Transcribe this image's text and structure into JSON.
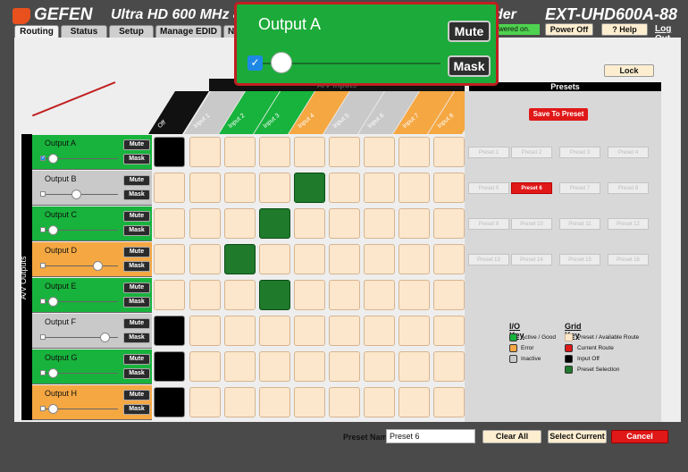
{
  "header": {
    "brand": "GEFEN",
    "product": "Ultra HD 600 MHz 8",
    "product_tail": "der",
    "model": "EXT-UHD600A-88",
    "power_status": "wered on.",
    "power_off": "Power Off",
    "help": "? Help",
    "logout": "Log Out"
  },
  "tabs": [
    "Routing",
    "Status",
    "Setup",
    "Manage EDID",
    "Net"
  ],
  "lock": "Lock",
  "av_inputs": "A/V Inputs",
  "av_outputs": "A/V Outputs",
  "input_labels": [
    "Off",
    "Input 1",
    "Input 2",
    "Input 3",
    "Input 4",
    "Input 5",
    "Input 6",
    "Input 7",
    "Input 8"
  ],
  "outputs": [
    {
      "name": "Output A",
      "mute": "Mute",
      "mask": "Mask",
      "status": "active",
      "checked": true,
      "volume": 0.02
    },
    {
      "name": "Output B",
      "mute": "Mute",
      "mask": "Mask",
      "status": "inactive",
      "checked": false,
      "volume": 0.33
    },
    {
      "name": "Output C",
      "mute": "Mute",
      "mask": "Mask",
      "status": "active",
      "checked": false,
      "volume": 0.02
    },
    {
      "name": "Output D",
      "mute": "Mute",
      "mask": "Mask",
      "status": "error",
      "checked": false,
      "volume": 0.6
    },
    {
      "name": "Output E",
      "mute": "Mute",
      "mask": "Mask",
      "status": "active",
      "checked": false,
      "volume": 0.02
    },
    {
      "name": "Output F",
      "mute": "Mute",
      "mask": "Mask",
      "status": "inactive",
      "checked": false,
      "volume": 0.7
    },
    {
      "name": "Output G",
      "mute": "Mute",
      "mask": "Mask",
      "status": "active",
      "checked": false,
      "volume": 0.02
    },
    {
      "name": "Output H",
      "mute": "Mute",
      "mask": "Mask",
      "status": "error",
      "checked": false,
      "volume": 0.02
    }
  ],
  "routing": [
    "off",
    "4",
    "3",
    "2",
    "3",
    "off",
    "off",
    "off"
  ],
  "presets": {
    "title": "Presets",
    "save": "Save To Preset",
    "items": [
      "Preset 1",
      "Preset 2",
      "Preset 3",
      "Preset 4",
      "Preset 5",
      "Preset 6",
      "Preset 7",
      "Preset 8",
      "Preset 9",
      "Preset 10",
      "Preset 11",
      "Preset 12",
      "Preset 13",
      "Preset 14",
      "Preset 15",
      "Preset 16"
    ],
    "selected": "Preset 6"
  },
  "io_key": {
    "title": "I/O Key",
    "items": [
      "Active / Good",
      "Error",
      "Inactive"
    ]
  },
  "grid_key": {
    "title": "Grid Key",
    "items": [
      "Preset / Available Route",
      "Current Route",
      "Input Off",
      "Preset Selection"
    ]
  },
  "footer": {
    "preset_name_label": "Preset Name",
    "preset_name_value": "Preset 6",
    "clear_all": "Clear All",
    "select_current": "Select Current",
    "cancel": "Cancel"
  },
  "zoom": {
    "name": "Output A",
    "mute": "Mute",
    "mask": "Mask"
  },
  "colors": {
    "active": "#17b33c",
    "error": "#f5a742",
    "inactive": "#c9c9c9",
    "route": "#1f7a2c",
    "accent_red": "#e01818"
  }
}
